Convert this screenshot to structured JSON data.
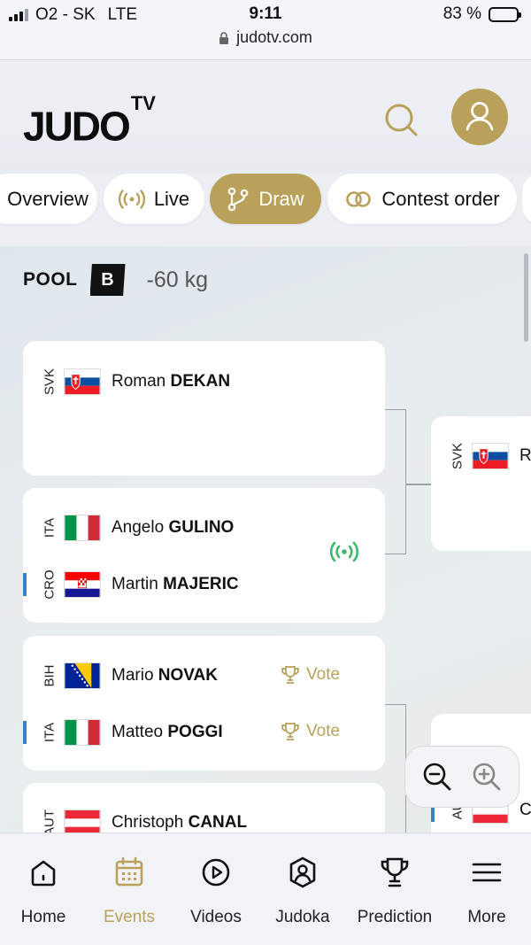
{
  "status_bar": {
    "carrier": "O2 - SK",
    "network": "LTE",
    "time": "9:11",
    "battery": "83 %",
    "battery_level": 0.83
  },
  "browser": {
    "url": "judotv.com"
  },
  "header": {
    "logo_main": "JUDO",
    "logo_sup": "TV",
    "search_icon": "search-icon",
    "profile_icon": "user-icon"
  },
  "tabs": [
    {
      "label": "Overview",
      "icon": "",
      "active": false
    },
    {
      "label": "Live",
      "icon": "live-broadcast-icon",
      "active": false
    },
    {
      "label": "Draw",
      "icon": "bracket-branch-icon",
      "active": true
    },
    {
      "label": "Contest order",
      "icon": "rings-icon",
      "active": false
    }
  ],
  "pool": {
    "label": "POOL",
    "letter": "B",
    "weight": "-60 kg"
  },
  "matches": [
    {
      "athletes": [
        {
          "country": "SVK",
          "first": "Roman",
          "last": "DEKAN"
        }
      ]
    },
    {
      "live": true,
      "athletes": [
        {
          "country": "ITA",
          "first": "Angelo",
          "last": "GULINO"
        },
        {
          "country": "CRO",
          "first": "Martin",
          "last": "MAJERIC"
        }
      ]
    },
    {
      "athletes": [
        {
          "country": "BIH",
          "first": "Mario",
          "last": "NOVAK",
          "vote": "Vote"
        },
        {
          "country": "ITA",
          "first": "Matteo",
          "last": "POGGI",
          "vote": "Vote"
        }
      ]
    },
    {
      "athletes": [
        {
          "country": "AUT",
          "first": "Christoph",
          "last": "CANAL"
        }
      ]
    }
  ],
  "next_round": [
    {
      "country": "SVK",
      "initial": "R"
    },
    {
      "country": "AU",
      "initial": "C"
    }
  ],
  "bottom_nav": [
    {
      "label": "Home",
      "icon": "home-icon",
      "active": false
    },
    {
      "label": "Events",
      "icon": "calendar-icon",
      "active": true
    },
    {
      "label": "Videos",
      "icon": "play-icon",
      "active": false
    },
    {
      "label": "Judoka",
      "icon": "judoka-icon",
      "active": false
    },
    {
      "label": "Prediction",
      "icon": "trophy-icon",
      "active": false
    },
    {
      "label": "More",
      "icon": "menu-icon",
      "active": false
    }
  ],
  "colors": {
    "accent": "#b9a15b",
    "live": "#3fb96a",
    "marker": "#3b82c4"
  }
}
